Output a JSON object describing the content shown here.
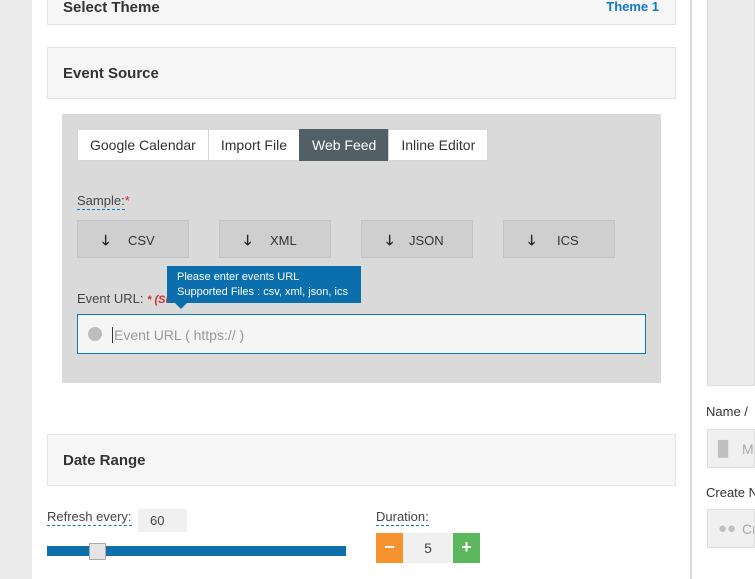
{
  "select_theme": {
    "title": "Select Theme",
    "theme_link": "Theme 1"
  },
  "event_source": {
    "title": "Event Source",
    "tabs": [
      {
        "label": "Google Calendar",
        "active": false
      },
      {
        "label": "Import File",
        "active": false
      },
      {
        "label": "Web Feed",
        "active": true
      },
      {
        "label": "Inline Editor",
        "active": false
      }
    ],
    "sample_label": "Sample:",
    "required_mark": "*",
    "sample_buttons": [
      {
        "label": "CSV",
        "icon": "arrow-down-icon"
      },
      {
        "label": "XML",
        "icon": "arrow-down-icon"
      },
      {
        "label": "JSON",
        "icon": "arrow-down-icon"
      },
      {
        "label": "ICS",
        "icon": "arrow-down-icon"
      }
    ],
    "event_url_label": "Event URL:",
    "event_url_required": "* (Su",
    "tooltip_line1": "Please enter events URL",
    "tooltip_line2": "Supported Files : csv, xml, json, ics",
    "event_url_placeholder": "Event URL ( https:// )",
    "event_url_icon": "globe-icon"
  },
  "date_range": {
    "title": "Date Range",
    "refresh_label": "Refresh every:",
    "refresh_value": "60",
    "slider_fraction": 0.15,
    "duration_label": "Duration:",
    "duration_value": "5",
    "minus_label": "−",
    "plus_label": "+"
  },
  "sidebar": {
    "name_label": "Name /",
    "name_placeholder": "M",
    "name_icon": "file-icon",
    "create_label": "Create N",
    "create_placeholder": "Cr",
    "create_icon": "users-icon"
  },
  "colors": {
    "accent": "#0e7bbf",
    "active_tab": "#515f66",
    "minus": "#f7932e",
    "plus": "#5cb85c",
    "required": "#d02b2b"
  }
}
